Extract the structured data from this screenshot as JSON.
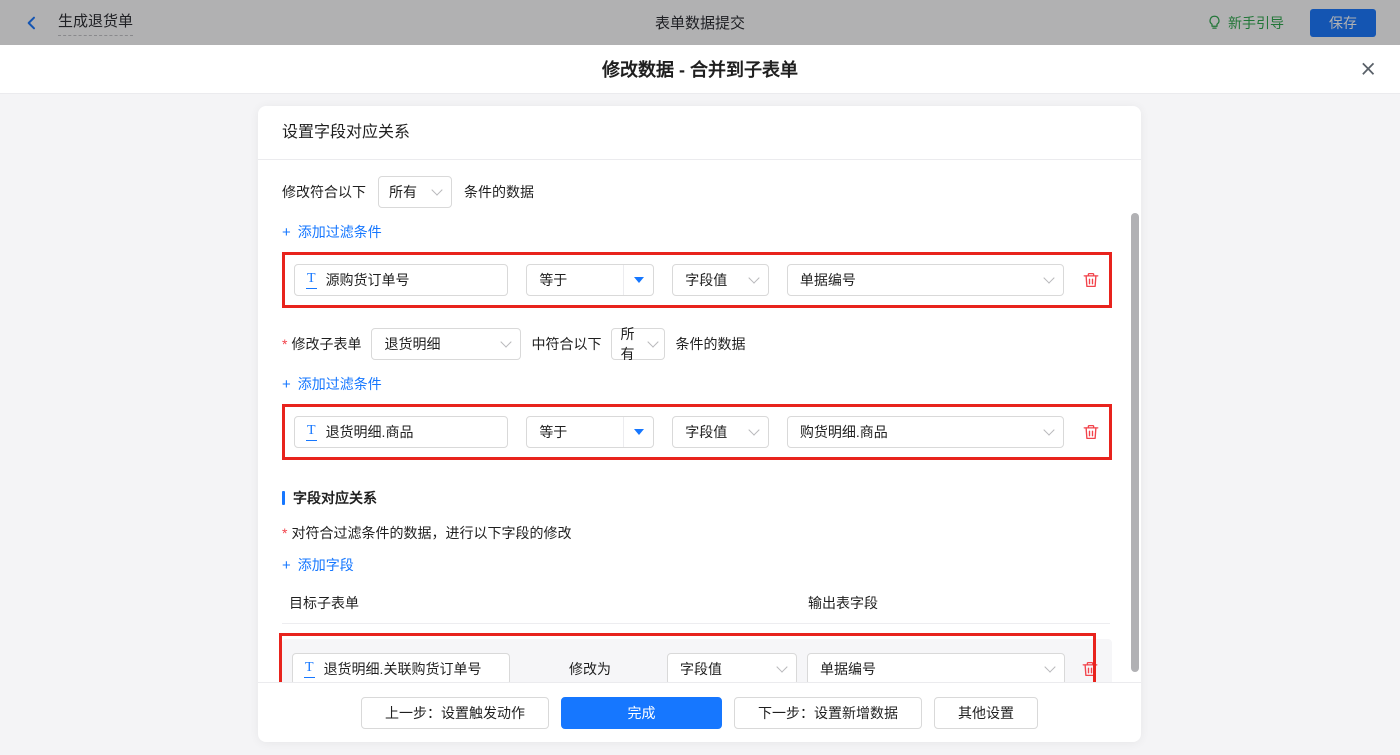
{
  "topbar": {
    "back_title": "生成退货单",
    "center_title": "表单数据提交",
    "guide_label": "新手引导",
    "save_label": "保存"
  },
  "dialog": {
    "title": "修改数据 - 合并到子表单",
    "close_icon": "×"
  },
  "card": {
    "header": "设置字段对应关系",
    "filter1": {
      "prefix": "修改符合以下",
      "match": "所有",
      "suffix": "条件的数据",
      "add_icon": "+",
      "add_label": "添加过滤条件",
      "row": {
        "field_icon": "T",
        "field": "源购货订单号",
        "operator": "等于",
        "value_type": "字段值",
        "value": "单据编号"
      }
    },
    "filter2": {
      "required_mark": "*",
      "label": "修改子表单",
      "subform": "退货明细",
      "middle": "中符合以下",
      "match": "所有",
      "suffix": "条件的数据",
      "add_icon": "+",
      "add_label": "添加过滤条件",
      "row": {
        "field_icon": "T",
        "field": "退货明细.商品",
        "operator": "等于",
        "value_type": "字段值",
        "value": "购货明细.商品"
      }
    },
    "mapping": {
      "section_title": "字段对应关系",
      "required_mark": "*",
      "description": "对符合过滤条件的数据，进行以下字段的修改",
      "add_icon": "+",
      "add_label": "添加字段",
      "col_target": "目标子表单",
      "col_output": "输出表字段",
      "row": {
        "field_icon": "T",
        "field": "退货明细.关联购货订单号",
        "action": "修改为",
        "value_type": "字段值",
        "value": "单据编号"
      }
    },
    "footer": {
      "prev": "上一步：设置触发动作",
      "done": "完成",
      "next": "下一步：设置新增数据",
      "other": "其他设置"
    }
  },
  "colors": {
    "accent_blue": "#1677ff",
    "highlight_red": "#e8231d",
    "guide_green": "#2ba84a",
    "trash_red": "#f2434b"
  }
}
